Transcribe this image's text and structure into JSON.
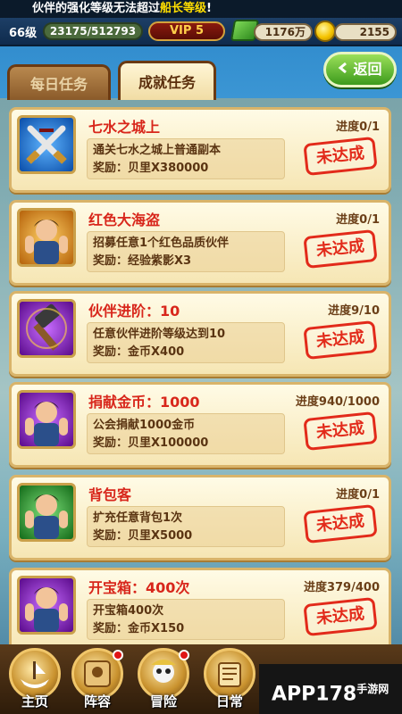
{
  "notice": {
    "prefix": "伙伴的强化等级无法超过",
    "highlight": "船长等级",
    "suffix": "!"
  },
  "status": {
    "level": "66级",
    "exp": "23175/512793",
    "vip": "VIP  5",
    "money": "1176万",
    "coins": "2155"
  },
  "tabs": {
    "daily": "每日任务",
    "achievement": "成就任务"
  },
  "back_button": "返回",
  "tasks": [
    {
      "title": "七水之城上",
      "progress": "进度0/1",
      "desc": "通关七水之城上普通副本",
      "reward": "奖励：贝里X380000",
      "status": "未达成",
      "icon": "crossed-swords-icon"
    },
    {
      "title": "红色大海盗",
      "progress": "进度0/1",
      "desc": "招募任意1个红色品质伙伴",
      "reward": "奖励：经验紫影X3",
      "status": "未达成",
      "icon": "pirate-avatar-icon"
    },
    {
      "title": "伙伴进阶：10",
      "progress": "进度9/10",
      "desc": "任意伙伴进阶等级达到10",
      "reward": "奖励：金币X400",
      "status": "未达成",
      "icon": "hammer-icon"
    },
    {
      "title": "捐献金币：1000",
      "progress": "进度940/1000",
      "desc": "公会捐献1000金币",
      "reward": "奖励：贝里X100000",
      "status": "未达成",
      "icon": "pirate-avatar-icon"
    },
    {
      "title": "背包客",
      "progress": "进度0/1",
      "desc": "扩充任意背包1次",
      "reward": "奖励：贝里X5000",
      "status": "未达成",
      "icon": "pirate-avatar-icon"
    },
    {
      "title": "开宝箱：400次",
      "progress": "进度379/400",
      "desc": "开宝箱400次",
      "reward": "奖励：金币X150",
      "status": "未达成",
      "icon": "pirate-avatar-icon"
    }
  ],
  "nav": [
    {
      "label": "主页",
      "icon": "ship-icon"
    },
    {
      "label": "阵容",
      "icon": "lineup-icon"
    },
    {
      "label": "冒险",
      "icon": "skull-icon"
    },
    {
      "label": "日常",
      "icon": "scroll-icon"
    }
  ],
  "watermark": {
    "main": "APP178",
    "sub": "手游网"
  }
}
